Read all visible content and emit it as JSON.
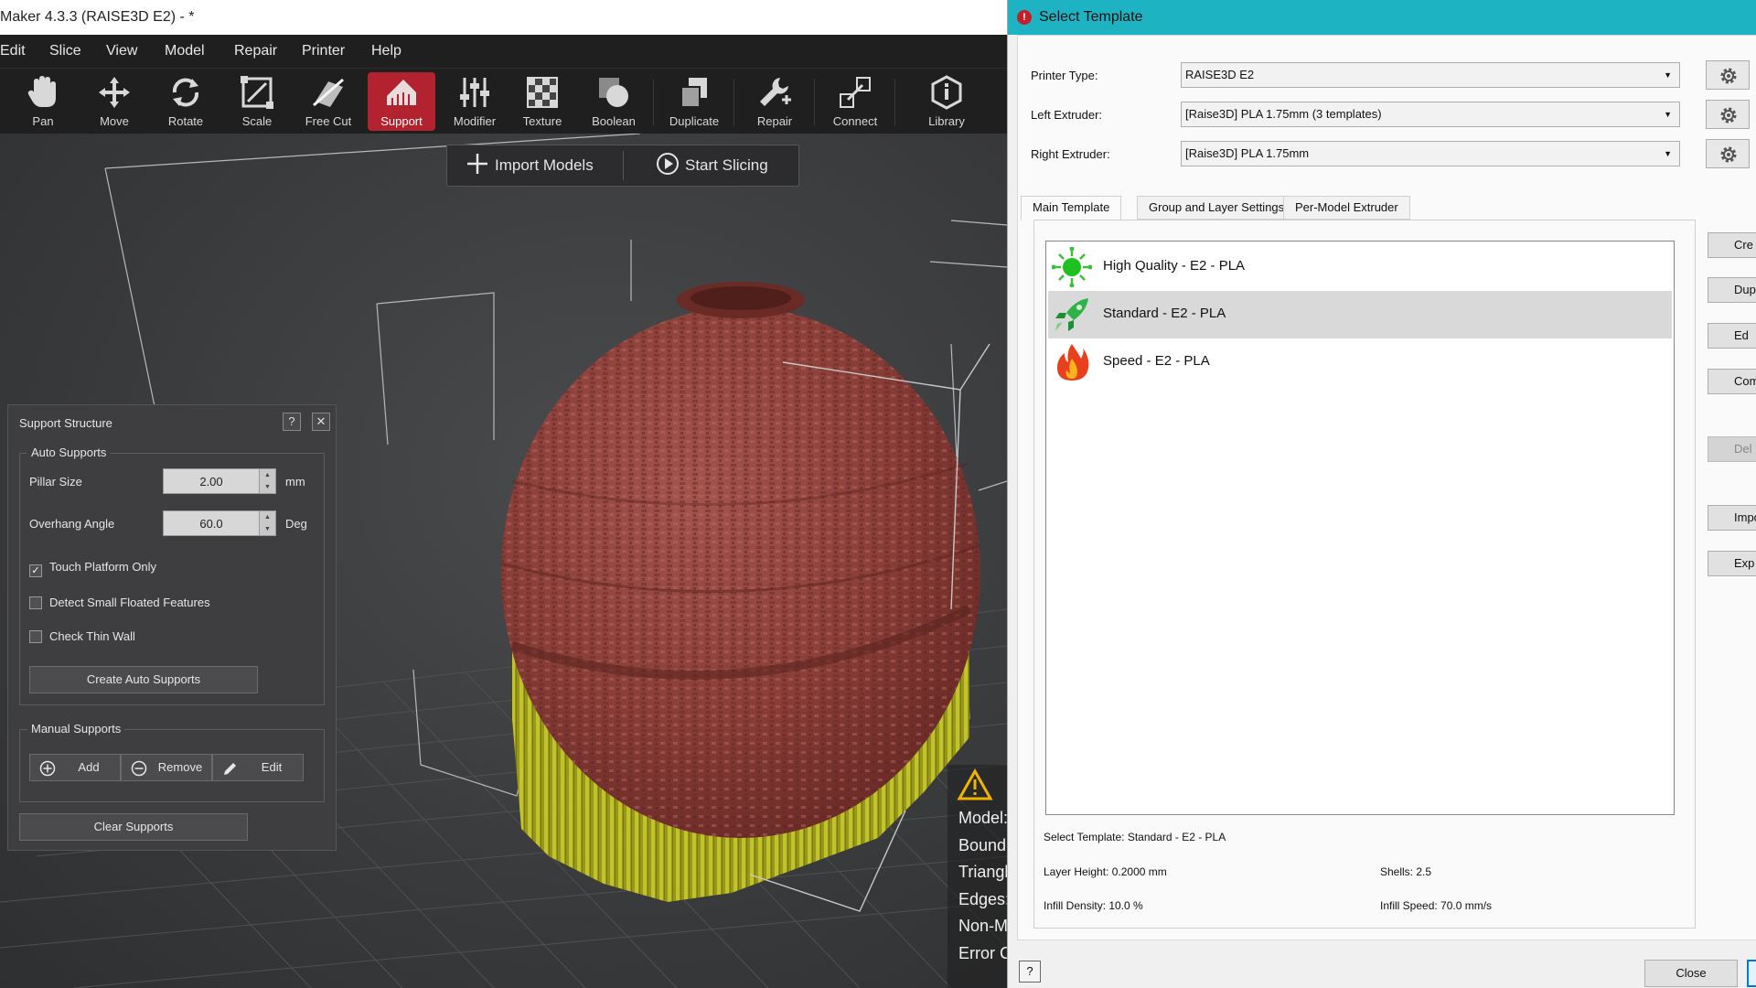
{
  "app": {
    "title": "Maker 4.3.3 (RAISE3D E2) - *",
    "menu": [
      "Edit",
      "Slice",
      "View",
      "Model",
      "Repair",
      "Printer",
      "Help"
    ],
    "toolbar": {
      "pan": "Pan",
      "move": "Move",
      "rotate": "Rotate",
      "scale": "Scale",
      "free_cut": "Free Cut",
      "support": "Support",
      "modifier": "Modifier",
      "texture": "Texture",
      "boolean": "Boolean",
      "duplicate": "Duplicate",
      "repair": "Repair",
      "connect": "Connect",
      "library": "Library"
    },
    "actions": {
      "import": "Import Models",
      "slice": "Start Slicing"
    },
    "colors": {
      "accent": "#b3232f",
      "model": "#8f403b",
      "supports": "#b5b520"
    }
  },
  "support_panel": {
    "title": "Support Structure",
    "help": "?",
    "close": "✕",
    "auto": {
      "legend": "Auto Supports",
      "pillar_label": "Pillar Size",
      "pillar_value": "2.00",
      "pillar_unit": "mm",
      "overhang_label": "Overhang Angle",
      "overhang_value": "60.0",
      "overhang_unit": "Deg",
      "touch_platform": "Touch Platform Only",
      "touch_platform_checked": true,
      "detect_small": "Detect Small Floated Features",
      "detect_small_checked": false,
      "check_thin": "Check Thin Wall",
      "check_thin_checked": false,
      "create_button": "Create Auto Supports"
    },
    "manual": {
      "legend": "Manual Supports",
      "add": "Add",
      "remove": "Remove",
      "edit": "Edit"
    },
    "clear_button": "Clear Supports"
  },
  "model_info": {
    "warning_icon": "warning-icon",
    "rows": [
      "Model:",
      "Bound",
      "Triangl",
      "Edges:",
      "Non-M",
      "Error C"
    ]
  },
  "dialog": {
    "title": "Select Template",
    "printer_type_label": "Printer Type:",
    "printer_type_value": "RAISE3D E2",
    "left_extruder_label": "Left Extruder:",
    "left_extruder_value": "[Raise3D] PLA 1.75mm (3 templates)",
    "right_extruder_label": "Right Extruder:",
    "right_extruder_value": "[Raise3D] PLA 1.75mm",
    "tabs": [
      "Main Template",
      "Group and Layer Settings",
      "Per-Model Extruder"
    ],
    "templates": [
      {
        "label": "High Quality - E2 - PLA",
        "icon": "high-quality-icon",
        "selected": false
      },
      {
        "label": "Standard - E2 - PLA",
        "icon": "rocket-icon",
        "selected": true
      },
      {
        "label": "Speed - E2 - PLA",
        "icon": "flame-icon",
        "selected": false
      }
    ],
    "selected_template": "Select Template: Standard - E2 - PLA",
    "layer_height": "Layer Height: 0.2000 mm",
    "shells": "Shells: 2.5",
    "infill_density": "Infill Density: 10.0 %",
    "infill_speed": "Infill Speed: 70.0 mm/s",
    "side_buttons": [
      "Cre",
      "Dupli",
      "Ed",
      "Com",
      "Del",
      "Impo",
      "Exp"
    ],
    "help": "?",
    "close": "Close"
  }
}
